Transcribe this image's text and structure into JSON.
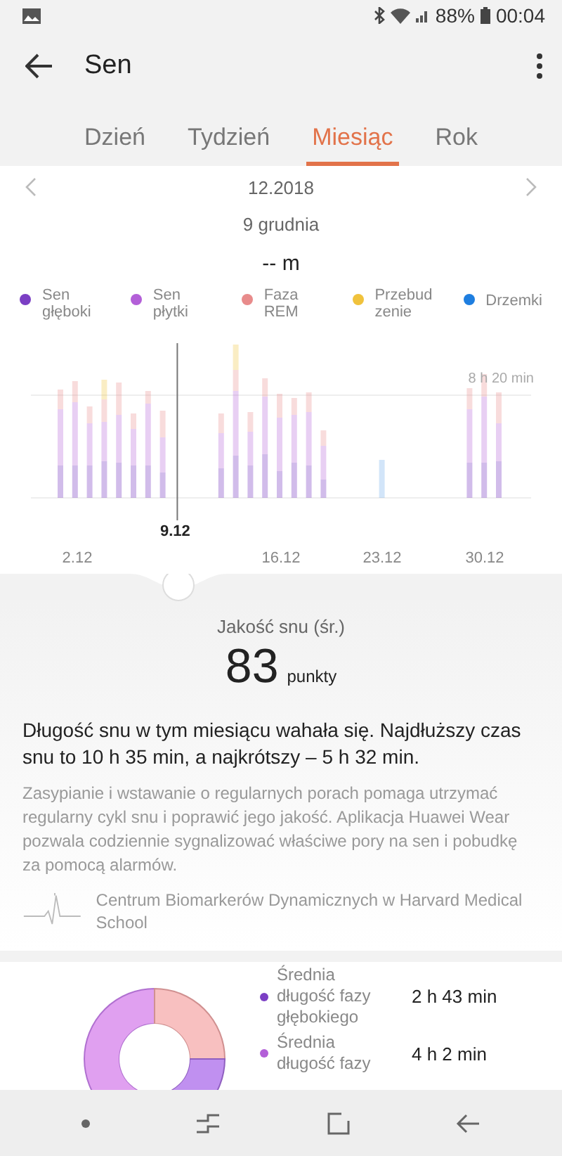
{
  "status_bar": {
    "battery": "88%",
    "time": "00:04"
  },
  "app_bar": {
    "title": "Sen"
  },
  "tabs": [
    {
      "label": "Dzień",
      "selected": false
    },
    {
      "label": "Tydzień",
      "selected": false
    },
    {
      "label": "Miesiąc",
      "selected": true
    },
    {
      "label": "Rok",
      "selected": false
    }
  ],
  "period": {
    "label": "12.2018",
    "day": "9 grudnia",
    "value": "-- m"
  },
  "legend": [
    {
      "label": "Sen głęboki",
      "color": "#7b3fc4"
    },
    {
      "label": "Sen płytki",
      "color": "#b35fd8"
    },
    {
      "label": "Faza REM",
      "color": "#e88b8b"
    },
    {
      "label": "Przebudzenie",
      "color": "#f0c23c"
    },
    {
      "label": "Drzemki",
      "color": "#1e7ee0"
    }
  ],
  "chart": {
    "reference_label": "8 h 20 min",
    "selected_label": "9.12",
    "x_labels": [
      "2.12",
      "16.12",
      "23.12",
      "30.12"
    ]
  },
  "quality": {
    "label": "Jakość snu (śr.)",
    "score": "83",
    "unit": "punkty",
    "summary": "Długość snu w tym miesiącu wahała się. Najdłuższy czas snu to 10 h 35 min, a najkrótszy – 5 h 32 min.",
    "tip": "Zasypianie i wstawanie o regularnych porach pomaga utrzymać regularny cykl snu i poprawić jego jakość. Aplikacja Huawei Wear pozwala codziennie sygnalizować właściwe pory na sen i pobudkę za pomocą alarmów.",
    "source": "Centrum Biomarkerów Dynamicznych w Harvard Medical School"
  },
  "stats": [
    {
      "label": "Średnia długość fazy głębokiego",
      "value": "2 h 43 min",
      "color": "#7b3fc4"
    },
    {
      "label": "Średnia długość fazy",
      "value": "4 h 2 min",
      "color": "#b35fd8"
    }
  ]
}
